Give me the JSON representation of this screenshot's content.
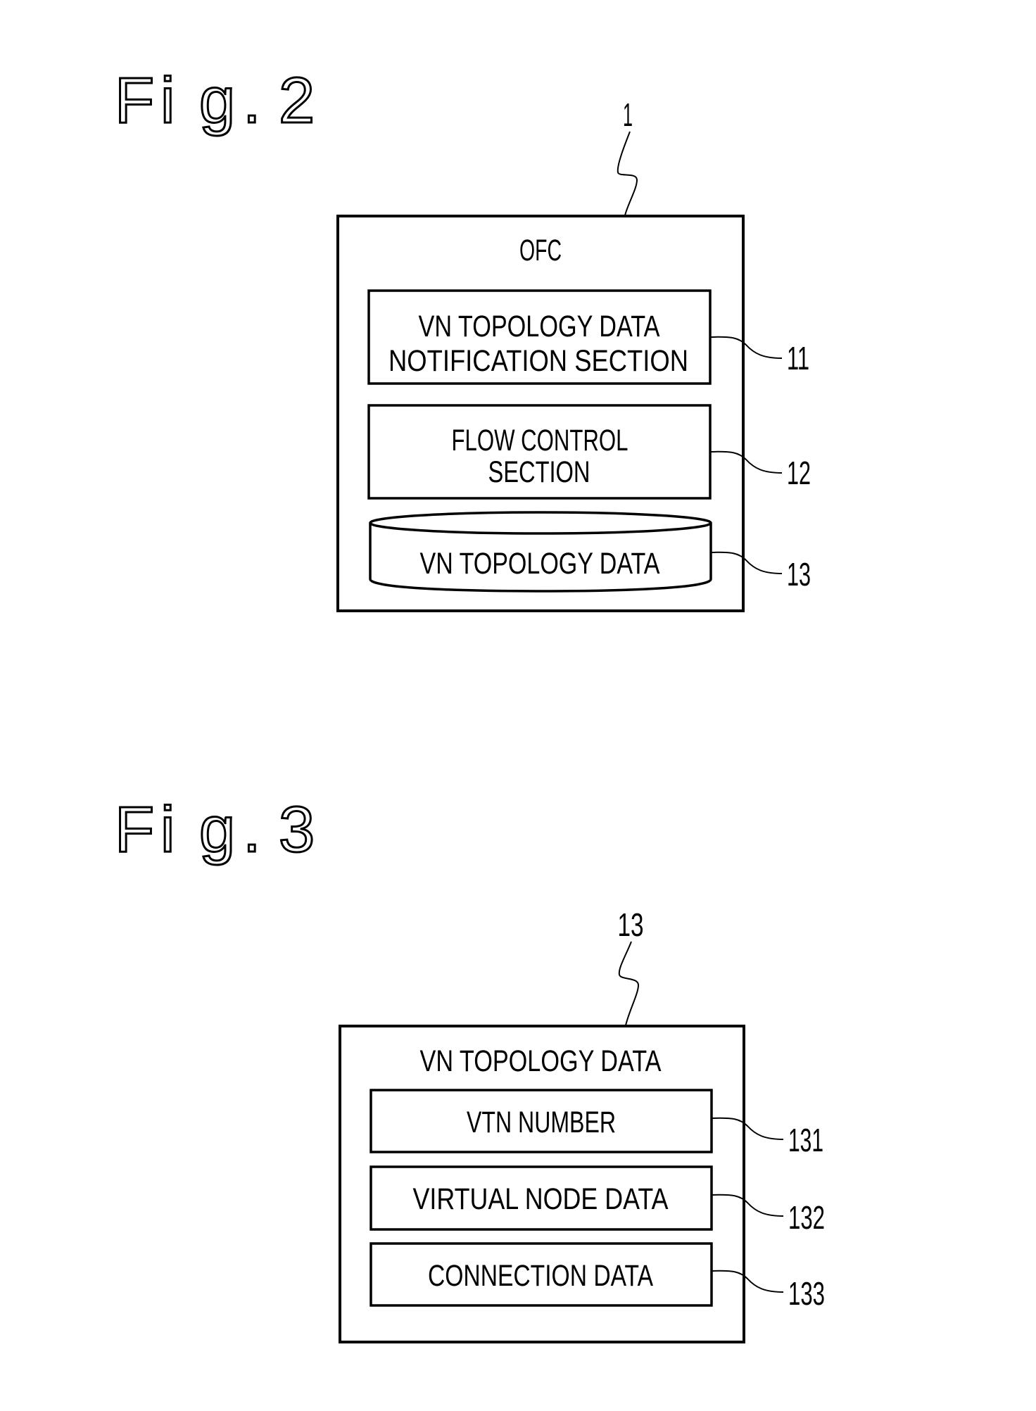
{
  "figures": [
    {
      "title": "Fig. 2",
      "title_chars": [
        "F",
        "i",
        "g",
        ".",
        "2"
      ],
      "ref": "1",
      "container_label": "OFC",
      "components": [
        {
          "ref": "11",
          "kind": "block",
          "lines": [
            "VN TOPOLOGY DATA",
            "NOTIFICATION SECTION"
          ]
        },
        {
          "ref": "12",
          "kind": "block",
          "lines": [
            "FLOW CONTROL",
            "SECTION"
          ]
        },
        {
          "ref": "13",
          "kind": "database",
          "lines": [
            "VN TOPOLOGY DATA"
          ]
        }
      ]
    },
    {
      "title": "Fig. 3",
      "title_chars": [
        "F",
        "i",
        "g",
        ".",
        "3"
      ],
      "ref": "13",
      "container_label": "VN TOPOLOGY DATA",
      "components": [
        {
          "ref": "131",
          "kind": "block",
          "lines": [
            "VTN NUMBER"
          ]
        },
        {
          "ref": "132",
          "kind": "block",
          "lines": [
            "VIRTUAL NODE DATA"
          ]
        },
        {
          "ref": "133",
          "kind": "block",
          "lines": [
            "CONNECTION DATA"
          ]
        }
      ]
    }
  ]
}
